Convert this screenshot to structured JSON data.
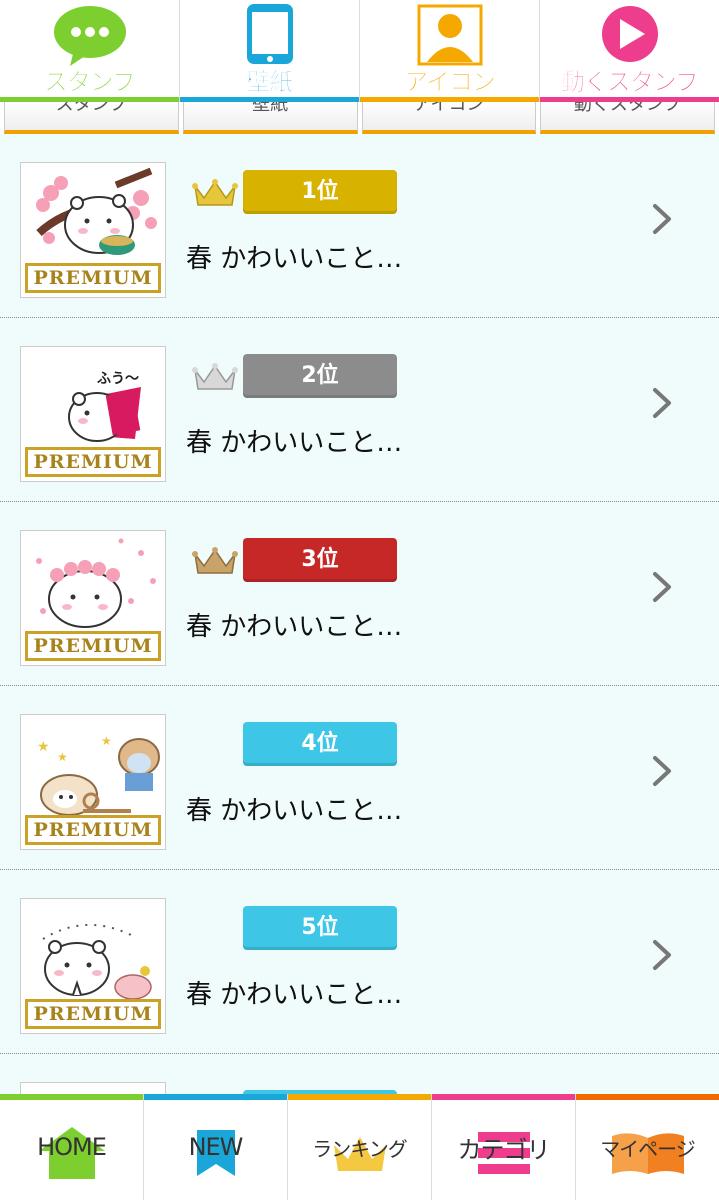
{
  "top_tabs": [
    {
      "label": "スタンプ",
      "icon": "chat-bubble-icon",
      "color": "#7ccf2e"
    },
    {
      "label": "壁紙",
      "icon": "smartphone-icon",
      "color": "#1aa6d9"
    },
    {
      "label": "アイコン",
      "icon": "person-icon",
      "color": "#f5a800"
    },
    {
      "label": "動くスタンプ",
      "icon": "play-icon",
      "color": "#ef3d8e"
    }
  ],
  "sub_tabs": [
    "スタンプ",
    "壁紙",
    "アイコン",
    "動くスタンプ"
  ],
  "ranking": [
    {
      "rank": "1位",
      "title": "春 かわいいこと…",
      "badge_color": "#d7b300",
      "crown": "gold",
      "premium": "PREMIUM"
    },
    {
      "rank": "2位",
      "title": "春 かわいいこと…",
      "badge_color": "#8c8c8c",
      "crown": "silver",
      "premium": "PREMIUM"
    },
    {
      "rank": "3位",
      "title": "春 かわいいこと…",
      "badge_color": "#c62828",
      "crown": "bronze",
      "premium": "PREMIUM"
    },
    {
      "rank": "4位",
      "title": "春 かわいいこと…",
      "badge_color": "#3ec6e6",
      "crown": "",
      "premium": "PREMIUM"
    },
    {
      "rank": "5位",
      "title": "春 かわいいこと…",
      "badge_color": "#3ec6e6",
      "crown": "",
      "premium": "PREMIUM"
    }
  ],
  "bottom_nav": [
    {
      "label": "HOME",
      "icon": "home-icon",
      "color": "#7ccf2e"
    },
    {
      "label": "NEW",
      "icon": "new-icon",
      "color": "#1aa6d9"
    },
    {
      "label": "ランキング",
      "icon": "ranking-icon",
      "color": "#f5a800"
    },
    {
      "label": "カテゴリ",
      "icon": "category-icon",
      "color": "#ef3d8e"
    },
    {
      "label": "マイページ",
      "icon": "book-icon",
      "color": "#f06a00"
    }
  ]
}
